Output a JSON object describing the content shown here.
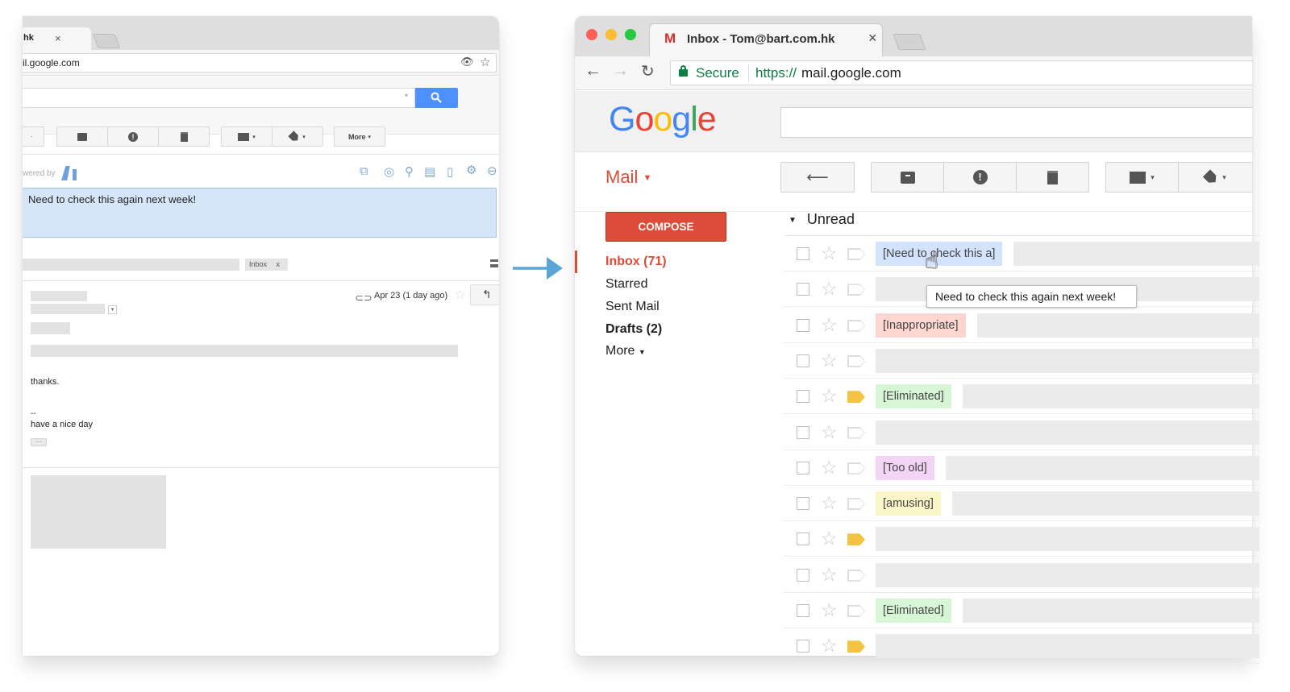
{
  "left_window": {
    "tab_title": "hk",
    "tab_close": "×",
    "url": "il.google.com",
    "more_label": "More",
    "powered_by": "wered by",
    "note_text": "Need to check this again next week!",
    "inbox_chip": "Inbox",
    "inbox_chip_close": "x",
    "email_date": "Apr 23 (1 day ago)",
    "body_thanks": "thanks.",
    "body_dashes": "--",
    "body_signoff": "have a nice day",
    "body_ellipsis": "···"
  },
  "right_window": {
    "tab_title": "Inbox - Tom@bart.com.hk",
    "tab_close": "×",
    "secure_label": "Secure",
    "url_scheme": "https://",
    "url_host": "mail.google.com",
    "logo_letters": [
      "G",
      "o",
      "o",
      "g",
      "l",
      "e"
    ],
    "logo_colors": [
      "#4285F4",
      "#EA4335",
      "#FBBC05",
      "#4285F4",
      "#34A853",
      "#EA4335"
    ],
    "mail_label": "Mail",
    "compose_label": "COMPOSE",
    "nav": {
      "inbox": "Inbox (71)",
      "starred": "Starred",
      "sent": "Sent Mail",
      "drafts": "Drafts (2)",
      "more": "More"
    },
    "section_label": "Unread",
    "tooltip": "Need to check this again next week!",
    "rows": [
      {
        "tag": "[Need to check this a]",
        "color": "#d3e3fc",
        "important": false
      },
      {
        "tag": "",
        "color": "",
        "important": false
      },
      {
        "tag": "[Inappropriate]",
        "color": "#fcd6cf",
        "important": false
      },
      {
        "tag": "",
        "color": "",
        "important": false
      },
      {
        "tag": "[Eliminated]",
        "color": "#d7f6d5",
        "important": true
      },
      {
        "tag": "",
        "color": "",
        "important": false
      },
      {
        "tag": "[Too old]",
        "color": "#f4d4f5",
        "important": false
      },
      {
        "tag": "[amusing]",
        "color": "#fbf6c7",
        "important": false
      },
      {
        "tag": "",
        "color": "",
        "important": true
      },
      {
        "tag": "",
        "color": "",
        "important": false
      },
      {
        "tag": "[Eliminated]",
        "color": "#d7f6d5",
        "important": false
      },
      {
        "tag": "",
        "color": "",
        "important": true
      }
    ]
  },
  "colors": {
    "accent_red": "#dd4b39",
    "search_blue": "#4d90fe",
    "arrow_blue": "#5aa5d6",
    "important_yellow": "#f4c341",
    "secure_green": "#0b8043"
  },
  "icons": [
    "close-icon",
    "eye-icon",
    "star-icon",
    "search-icon",
    "archive-icon",
    "spam-icon",
    "delete-icon",
    "folder-icon",
    "label-icon",
    "reply-icon",
    "print-icon",
    "attachment-icon",
    "lock-icon",
    "back-icon",
    "forward-icon",
    "reload-icon",
    "gmail-icon",
    "caret-down-icon",
    "cursor-hand-icon",
    "arrow-right-icon"
  ]
}
